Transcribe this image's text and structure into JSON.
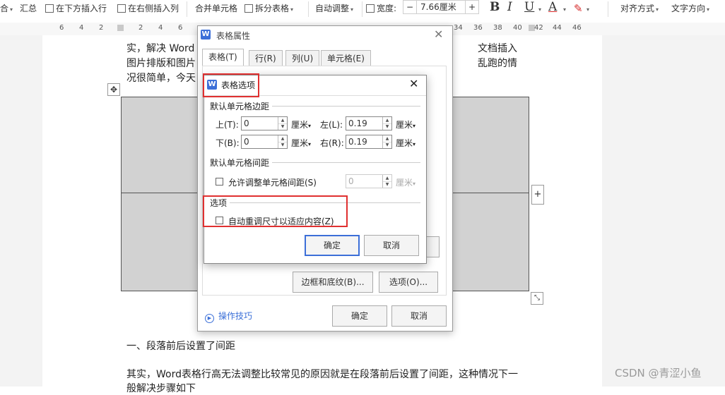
{
  "toolbar": {
    "merge_partial": "合",
    "summary": "汇总",
    "insert_below": "在下方插入行",
    "insert_right": "在右侧插入列",
    "merge_cells": "合并单元格",
    "split_table": "拆分表格",
    "auto_fit": "自动调整",
    "width_label": "宽度:",
    "width_value": "7.66厘米",
    "bold": "B",
    "italic": "I",
    "underline": "U",
    "font_color": "A",
    "align": "对齐方式",
    "text_direction": "文字方向",
    "minus": "−",
    "plus": "+"
  },
  "ruler": {
    "ticks": [
      "6",
      "4",
      "2",
      "2",
      "4",
      "6",
      "34",
      "36",
      "38",
      "40",
      "42",
      "44",
      "46"
    ]
  },
  "doc": {
    "line1a": "实，解决 Word",
    "line1b": "文档插入",
    "line2a": "图片排版和图片",
    "line2b": "乱跑的情",
    "line3": "况很简单，今天",
    "heading": "一、段落前后设置了间距",
    "para1": "其实，Word表格行高无法调整比较常见的原因就是在段落前后设置了间距，这种情况下一",
    "para2": "般解决步骤如下"
  },
  "outer_dialog": {
    "title": "表格属性",
    "tabs": [
      "表格(T)",
      "行(R)",
      "列(U)",
      "单元格(E)"
    ],
    "border_shading": "边框和底纹(B)...",
    "options": "选项(O)...",
    "tips": "操作技巧",
    "ok": "确定",
    "cancel": "取消"
  },
  "inner_dialog": {
    "title": "表格选项",
    "section_margins": "默认单元格边距",
    "top_label": "上(T):",
    "top_value": "0",
    "left_label": "左(L):",
    "left_value": "0.19",
    "bottom_label": "下(B):",
    "bottom_value": "0",
    "right_label": "右(R):",
    "right_value": "0.19",
    "unit": "厘米",
    "section_spacing": "默认单元格间距",
    "allow_spacing": "允许调整单元格间距(S)",
    "spacing_value": "0",
    "section_options": "选项",
    "auto_resize": "自动重调尺寸以适应内容(Z)",
    "ok": "确定",
    "cancel": "取消"
  },
  "watermark": "CSDN @青涩小鱼",
  "colors": {
    "accent": "#3c6fd8",
    "highlight_red": "#e03030",
    "table_fill": "#d2d2d2"
  }
}
